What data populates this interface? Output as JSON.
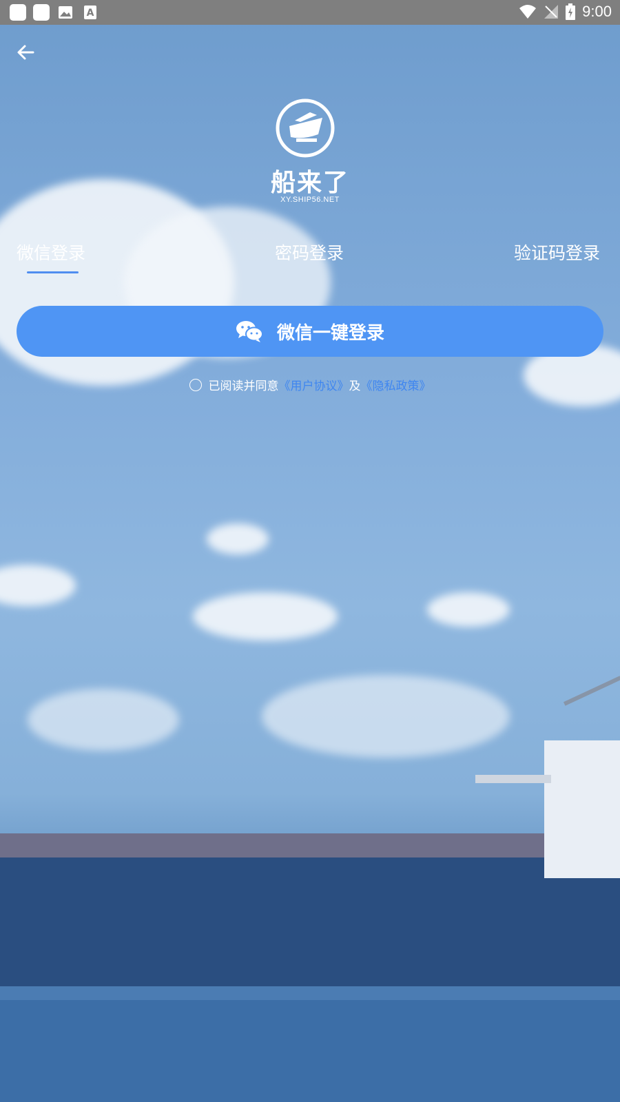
{
  "status_bar": {
    "time": "9:00"
  },
  "brand": {
    "name": "船来了",
    "site": "XY.SHIP56.NET"
  },
  "tabs": [
    {
      "label": "微信登录"
    },
    {
      "label": "密码登录"
    },
    {
      "label": "验证码登录"
    }
  ],
  "login_button": {
    "label": "微信一键登录"
  },
  "agreement": {
    "prefix": "已阅读并同意",
    "user_agreement": "《用户协议》",
    "and": "及",
    "privacy_policy": "《隐私政策》"
  },
  "colors": {
    "accent": "#4f95f4",
    "link": "#3f86f0"
  },
  "icons": [
    "back-arrow-icon",
    "wechat-icon",
    "logo-ship-icon",
    "wifi-icon",
    "signal-icon",
    "battery-icon"
  ]
}
